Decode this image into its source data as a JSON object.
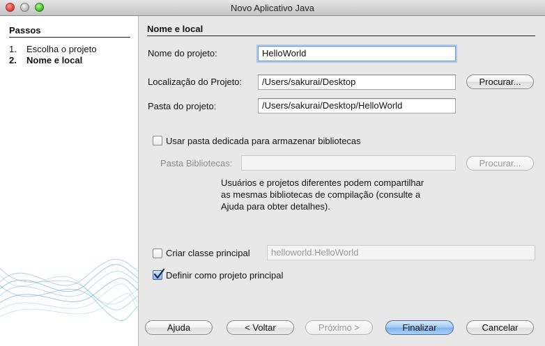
{
  "window": {
    "title": "Novo Aplicativo Java"
  },
  "sidebar": {
    "heading": "Passos",
    "steps": [
      {
        "num": "1.",
        "label": "Escolha o projeto",
        "active": false
      },
      {
        "num": "2.",
        "label": "Nome e local",
        "active": true
      }
    ]
  },
  "main": {
    "section_title": "Nome e local",
    "project_name": {
      "label": "Nome do projeto:",
      "value": "HelloWorld"
    },
    "project_location": {
      "label": "Localização do Projeto:",
      "value": "/Users/sakurai/Desktop",
      "browse_label": "Procurar..."
    },
    "project_folder": {
      "label": "Pasta do projeto:",
      "value": "/Users/sakurai/Desktop/HelloWorld"
    },
    "dedicated_folder": {
      "label": "Usar pasta dedicada para armazenar bibliotecas",
      "checked": false
    },
    "libraries_folder": {
      "label": "Pasta Bibliotecas:",
      "value": "",
      "browse_label": "Procurar..."
    },
    "help_text": "Usuários e projetos diferentes podem compartilhar as mesmas bibliotecas de compilação (consulte a Ajuda para obter detalhes).",
    "main_class": {
      "label": "Criar classe principal",
      "checked": false,
      "value": "helloworld.HelloWorld"
    },
    "set_main_project": {
      "label": "Definir como projeto principal",
      "checked": true
    }
  },
  "footer": {
    "help": "Ajuda",
    "back": "< Voltar",
    "next": "Próximo >",
    "finish": "Finalizar",
    "cancel": "Cancelar"
  }
}
